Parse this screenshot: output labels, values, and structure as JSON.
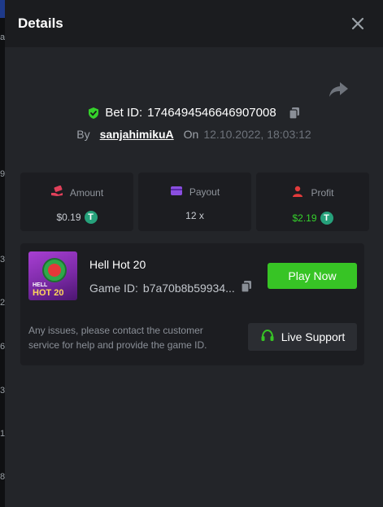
{
  "modal": {
    "title": "Details"
  },
  "bet": {
    "label": "Bet ID:",
    "id": "1746494546646907008",
    "by_label": "By",
    "username": "sanjahimikuA",
    "on_label": "On",
    "datetime": "12.10.2022, 18:03:12"
  },
  "stats": {
    "amount": {
      "label": "Amount",
      "value": "$0.19",
      "icon": "money-hand-icon"
    },
    "payout": {
      "label": "Payout",
      "value": "12 x",
      "icon": "wallet-icon"
    },
    "profit": {
      "label": "Profit",
      "value": "$2.19",
      "icon": "person-coin-icon"
    }
  },
  "currency_icon": "usdt-icon",
  "game": {
    "name": "Hell Hot 20",
    "thumb_top": "HELL",
    "thumb_bottom": "HOT 20",
    "id_label": "Game ID:",
    "id_value": "b7a70b8b59934...",
    "play_label": "Play Now"
  },
  "support": {
    "help_text": "Any issues, please contact the customer service for help and provide the game ID.",
    "button_label": "Live Support"
  },
  "backdrop_ticks": [
    "a",
    "9",
    "3",
    "2",
    "6",
    "3",
    "1",
    "8"
  ],
  "colors": {
    "accent_green": "#37c425",
    "profit_green": "#35d12b",
    "amount_icon": "#e0405a",
    "payout_icon": "#8a4fe0",
    "profit_icon": "#e23b3b"
  }
}
